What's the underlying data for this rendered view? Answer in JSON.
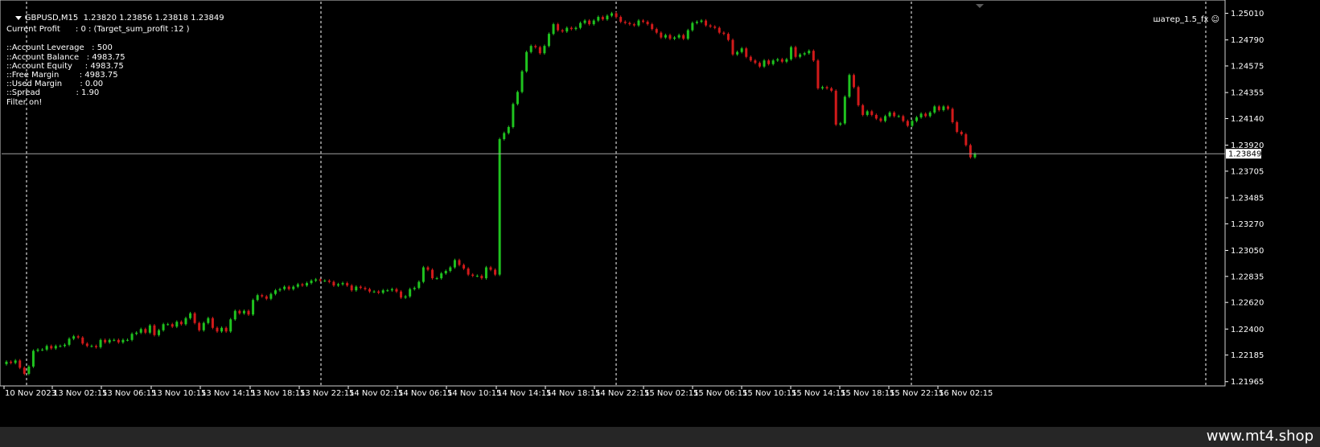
{
  "header": {
    "symbol_line": "GBPUSD,M15  1.23820 1.23856 1.23818 1.23849",
    "ea_name": "шатер_1.5_fx"
  },
  "info": {
    "current_profit": "Current Profit      : 0 : (Target_sum_profit :12 )",
    "lines": [
      "::Account Leverage   : 500",
      "::Account Balance   : 4983.75",
      "::Account Equity     : 4983.75",
      "::Free Margin        : 4983.75",
      "::Used Margin       : 0.00",
      "::Spread              : 1.90",
      "Filter on!"
    ]
  },
  "chart_data": {
    "type": "candlestick",
    "symbol": "GBPUSD",
    "timeframe": "M15",
    "ohlc_current": {
      "open": 1.2382,
      "high": 1.23856,
      "low": 1.23818,
      "close": 1.23849
    },
    "current_price": 1.23849,
    "current_price_label": "1.23849",
    "ylim": [
      1.2193,
      1.2512
    ],
    "y_ticks": [
      1.2501,
      1.2479,
      1.24575,
      1.24355,
      1.2414,
      1.2392,
      1.23705,
      1.23485,
      1.2327,
      1.2305,
      1.22835,
      1.2262,
      1.224,
      1.22185,
      1.21965
    ],
    "y_tick_labels": [
      "1.25010",
      "1.24790",
      "1.24575",
      "1.24355",
      "1.24140",
      "1.23920",
      "1.23705",
      "1.23485",
      "1.23270",
      "1.23050",
      "1.22835",
      "1.22620",
      "1.22400",
      "1.22185",
      "1.21965"
    ],
    "x_tick_labels": [
      "10 Nov 2023",
      "13 Nov 02:15",
      "13 Nov 06:15",
      "13 Nov 10:15",
      "13 Nov 14:15",
      "13 Nov 18:15",
      "13 Nov 22:15",
      "14 Nov 02:15",
      "14 Nov 06:15",
      "14 Nov 10:15",
      "14 Nov 14:15",
      "14 Nov 18:15",
      "14 Nov 22:15",
      "15 Nov 02:15",
      "15 Nov 06:15",
      "15 Nov 10:15",
      "15 Nov 14:15",
      "15 Nov 18:15",
      "15 Nov 22:15",
      "16 Nov 02:15"
    ],
    "closes": [
      1.2213,
      1.2212,
      1.2214,
      1.2208,
      1.2203,
      1.2209,
      1.2222,
      1.2223,
      1.2223,
      1.2226,
      1.2224,
      1.2226,
      1.2226,
      1.2227,
      1.2232,
      1.2234,
      1.2233,
      1.2228,
      1.2226,
      1.2226,
      1.2225,
      1.2231,
      1.2229,
      1.2231,
      1.2231,
      1.2229,
      1.2231,
      1.2231,
      1.2236,
      1.2237,
      1.224,
      1.2237,
      1.2243,
      1.2235,
      1.2239,
      1.2244,
      1.2244,
      1.2242,
      1.2246,
      1.2244,
      1.2249,
      1.2253,
      1.2245,
      1.2239,
      1.2245,
      1.2249,
      1.2241,
      1.2238,
      1.2241,
      1.2238,
      1.2248,
      1.2255,
      1.2253,
      1.2255,
      1.2252,
      1.2264,
      1.2268,
      1.2267,
      1.2265,
      1.2269,
      1.2272,
      1.2273,
      1.2275,
      1.2273,
      1.2275,
      1.2277,
      1.2276,
      1.2278,
      1.228,
      1.2281,
      1.228,
      1.228,
      1.2279,
      1.2276,
      1.2277,
      1.2278,
      1.2276,
      1.2272,
      1.2275,
      1.2274,
      1.2273,
      1.2271,
      1.2271,
      1.227,
      1.2272,
      1.2272,
      1.2273,
      1.2271,
      1.2266,
      1.2267,
      1.2273,
      1.2274,
      1.2279,
      1.2291,
      1.2289,
      1.2282,
      1.2282,
      1.2286,
      1.2288,
      1.2291,
      1.2297,
      1.2293,
      1.229,
      1.2285,
      1.2284,
      1.2284,
      1.2282,
      1.2291,
      1.2289,
      1.2285,
      1.2397,
      1.2402,
      1.2407,
      1.2426,
      1.2436,
      1.2453,
      1.2469,
      1.2474,
      1.2473,
      1.2468,
      1.2474,
      1.2484,
      1.2492,
      1.2487,
      1.2486,
      1.2489,
      1.2488,
      1.2489,
      1.2493,
      1.2495,
      1.2492,
      1.2495,
      1.2498,
      1.2496,
      1.2499,
      1.2501,
      1.2498,
      1.2494,
      1.2493,
      1.2492,
      1.2491,
      1.2495,
      1.2494,
      1.2492,
      1.2488,
      1.2485,
      1.2481,
      1.2483,
      1.248,
      1.2481,
      1.2483,
      1.248,
      1.2487,
      1.2493,
      1.2494,
      1.2495,
      1.2491,
      1.249,
      1.2489,
      1.2485,
      1.2484,
      1.2479,
      1.2467,
      1.2469,
      1.2472,
      1.2465,
      1.2462,
      1.246,
      1.2457,
      1.2462,
      1.2459,
      1.2462,
      1.2463,
      1.2461,
      1.2463,
      1.2473,
      1.2465,
      1.2467,
      1.2468,
      1.247,
      1.2462,
      1.2439,
      1.244,
      1.2439,
      1.2437,
      1.2409,
      1.241,
      1.2432,
      1.245,
      1.244,
      1.2425,
      1.2417,
      1.242,
      1.2417,
      1.2414,
      1.2412,
      1.2416,
      1.2419,
      1.2416,
      1.2416,
      1.2412,
      1.2408,
      1.2412,
      1.2415,
      1.2418,
      1.2416,
      1.2419,
      1.2424,
      1.2421,
      1.2424,
      1.2422,
      1.2411,
      1.2403,
      1.2401,
      1.2392,
      1.2382,
      1.23849
    ]
  },
  "footer": {
    "url": "www.mt4.shop"
  }
}
